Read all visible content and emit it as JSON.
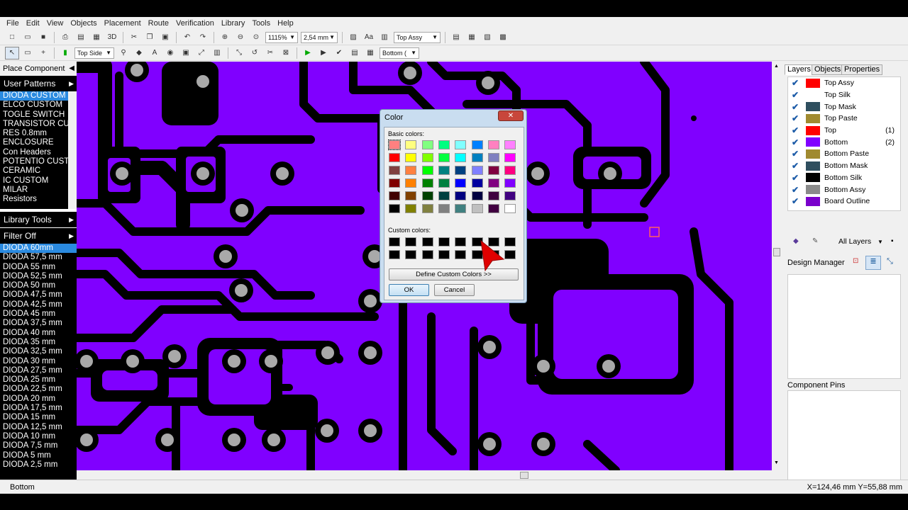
{
  "menu": [
    "File",
    "Edit",
    "View",
    "Objects",
    "Placement",
    "Route",
    "Verification",
    "Library",
    "Tools",
    "Help"
  ],
  "toolbar1": {
    "icons": [
      "new-icon",
      "open-icon",
      "save-icon",
      "print-icon",
      "print-preview-icon",
      "export-icon",
      "3d-view-icon",
      "cut-icon",
      "copy-icon",
      "paste-icon",
      "undo-icon",
      "redo-icon",
      "zoom-in-icon",
      "zoom-out-icon",
      "zoom-fit-icon"
    ],
    "label_3d": "3D",
    "zoom": "1115%",
    "grid": "2,54 mm",
    "view_layer": "Top Assy"
  },
  "toolbar2": {
    "side": "Top Side",
    "active_layer": "Bottom ("
  },
  "left_panel": {
    "place_component": "Place Component",
    "user_patterns": "User Patterns",
    "patterns": [
      "DIODA CUSTOM",
      "ELCO CUSTOM",
      "TOGLE SWITCH",
      "TRANSISTOR CU",
      "RES 0.8mm",
      "ENCLOSURE",
      "Con Headers",
      "POTENTIO CUST",
      "CERAMIC",
      "IC CUSTOM",
      "MILAR",
      "Resistors"
    ],
    "library_tools": "Library Tools",
    "filter": "Filter Off",
    "components": [
      "DIODA 60mm",
      "DIODA 57,5 mm",
      "DIODA 55 mm",
      "DIODA 52,5 mm",
      "DIODA 50 mm",
      "DIODA 47,5 mm",
      "DIODA 42,5 mm",
      "DIODA 45 mm",
      "DIODA 37,5 mm",
      "DIODA 40 mm",
      "DIODA 35 mm",
      "DIODA 32,5 mm",
      "DIODA 30 mm",
      "DIODA 27,5 mm",
      "DIODA 25 mm",
      "DIODA 22,5 mm",
      "DIODA 20 mm",
      "DIODA 17,5 mm",
      "DIODA 15 mm",
      "DIODA 12,5 mm",
      "DIODA 10 mm",
      "DIODA 7,5 mm",
      "DIODA 5 mm",
      "DIODA 2,5 mm"
    ]
  },
  "right_panel": {
    "tabs": [
      "Layers",
      "Objects",
      "Properties"
    ],
    "layers": [
      {
        "name": "Top Assy",
        "color": "#ff0000",
        "count": ""
      },
      {
        "name": "Top Silk",
        "color": "#ffffff",
        "count": ""
      },
      {
        "name": "Top Mask",
        "color": "#2f4f5f",
        "count": ""
      },
      {
        "name": "Top Paste",
        "color": "#a08a30",
        "count": ""
      },
      {
        "name": "Top",
        "color": "#ff0000",
        "count": "(1)"
      },
      {
        "name": "Bottom",
        "color": "#8000ff",
        "count": "(2)"
      },
      {
        "name": "Bottom Paste",
        "color": "#a08a30",
        "count": ""
      },
      {
        "name": "Bottom Mask",
        "color": "#2f4f5f",
        "count": ""
      },
      {
        "name": "Bottom Silk",
        "color": "#000000",
        "count": ""
      },
      {
        "name": "Bottom Assy",
        "color": "#8a8a8a",
        "count": ""
      },
      {
        "name": "Board Outline",
        "color": "#7a00cc",
        "count": ""
      }
    ],
    "layer_filter": "All Layers",
    "design_manager": "Design Manager",
    "component_pins": "Component Pins"
  },
  "status": {
    "layer": "Bottom",
    "coords": "X=124,46 mm  Y=55,88 mm"
  },
  "color_dialog": {
    "title": "Color",
    "basic_label": "Basic colors:",
    "custom_label": "Custom colors:",
    "define_button": "Define Custom Colors >>",
    "ok": "OK",
    "cancel": "Cancel",
    "basic_colors": [
      "#ff8080",
      "#ffff80",
      "#80ff80",
      "#00ff80",
      "#80ffff",
      "#0080ff",
      "#ff80c0",
      "#ff80ff",
      "#ff0000",
      "#ffff00",
      "#80ff00",
      "#00ff40",
      "#00ffff",
      "#0080c0",
      "#8080c0",
      "#ff00ff",
      "#804040",
      "#ff8040",
      "#00ff00",
      "#008080",
      "#004080",
      "#8080ff",
      "#800040",
      "#ff0080",
      "#800000",
      "#ff8000",
      "#008000",
      "#008040",
      "#0000ff",
      "#0000a0",
      "#800080",
      "#8000ff",
      "#400000",
      "#804000",
      "#004000",
      "#004040",
      "#000080",
      "#000040",
      "#400040",
      "#400080",
      "#000000",
      "#808000",
      "#808040",
      "#808080",
      "#408080",
      "#c0c0c0",
      "#400040",
      "#ffffff"
    ],
    "custom_colors": [
      "#000000",
      "#000000",
      "#000000",
      "#000000",
      "#000000",
      "#000000",
      "#000000",
      "#000000",
      "#000000",
      "#000000",
      "#000000",
      "#000000",
      "#000000",
      "#000000",
      "#000000",
      "#000000"
    ]
  }
}
